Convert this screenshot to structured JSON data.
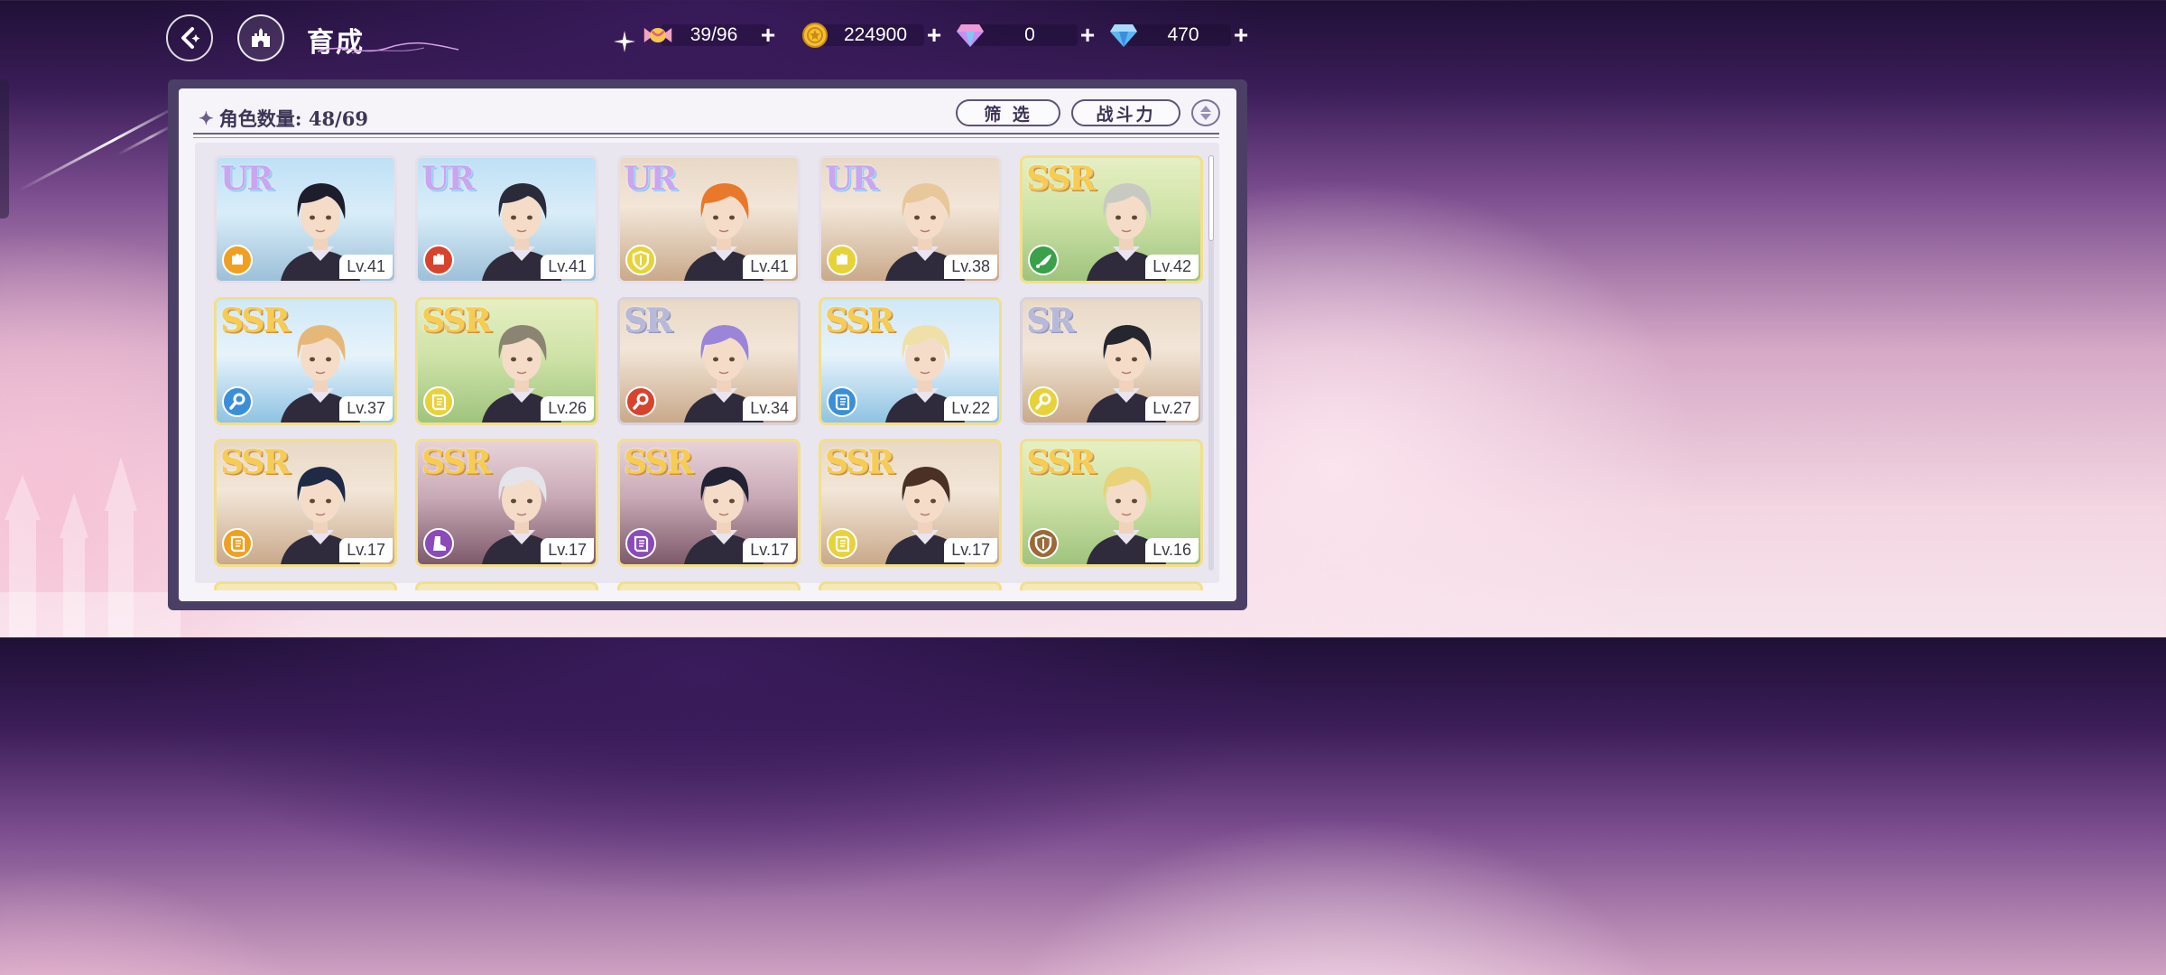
{
  "header": {
    "title": "育成",
    "back_icon": "back-arrow-icon",
    "home_icon": "castle-icon"
  },
  "resources": [
    {
      "name": "candy",
      "icon": "candy-icon",
      "value": "39/96"
    },
    {
      "name": "gold",
      "icon": "gold-coin-icon",
      "value": "224900"
    },
    {
      "name": "pink-gem",
      "icon": "pink-diamond-icon",
      "value": "0"
    },
    {
      "name": "blue-gem",
      "icon": "blue-diamond-icon",
      "value": "470"
    }
  ],
  "panel": {
    "count_label": "角色数量: 48/69",
    "filter_label": "筛 选",
    "sort_label": "战斗力"
  },
  "cards": [
    {
      "rarity": "UR",
      "level": "Lv.41",
      "attr": "fist",
      "attr_color": "#f0a020",
      "hair": "#1e1d2b",
      "bg": "city"
    },
    {
      "rarity": "UR",
      "level": "Lv.41",
      "attr": "fist",
      "attr_color": "#d8432e",
      "hair": "#2a2a3a",
      "bg": "city"
    },
    {
      "rarity": "UR",
      "level": "Lv.41",
      "attr": "shield",
      "attr_color": "#e7d23a",
      "hair": "#e9782a",
      "bg": "town"
    },
    {
      "rarity": "UR",
      "level": "Lv.38",
      "attr": "fist",
      "attr_color": "#e7d23a",
      "hair": "#e8c79a",
      "bg": "town"
    },
    {
      "rarity": "SSR",
      "level": "Lv.42",
      "attr": "horn",
      "attr_color": "#3aa04a",
      "hair": "#c9c9c4",
      "bg": "forest"
    },
    {
      "rarity": "SSR",
      "level": "Lv.37",
      "attr": "magnifier",
      "attr_color": "#3a8fd8",
      "hair": "#e6b878",
      "bg": "lake"
    },
    {
      "rarity": "SSR",
      "level": "Lv.26",
      "attr": "book",
      "attr_color": "#e7d23a",
      "hair": "#8b8472",
      "bg": "forest"
    },
    {
      "rarity": "SR",
      "level": "Lv.34",
      "attr": "magnifier",
      "attr_color": "#d8432e",
      "hair": "#9b85d8",
      "bg": "town"
    },
    {
      "rarity": "SSR",
      "level": "Lv.22",
      "attr": "book",
      "attr_color": "#3a8fd8",
      "hair": "#efe0a8",
      "bg": "lake"
    },
    {
      "rarity": "SR",
      "level": "Lv.27",
      "attr": "magnifier",
      "attr_color": "#e7d23a",
      "hair": "#26262e",
      "bg": "town"
    },
    {
      "rarity": "SSR",
      "level": "Lv.17",
      "attr": "book",
      "attr_color": "#f0a020",
      "hair": "#1f2a44",
      "bg": "town"
    },
    {
      "rarity": "SSR",
      "level": "Lv.17",
      "attr": "boot",
      "attr_color": "#8a4ab8",
      "hair": "#e4e4ea",
      "bg": "temple"
    },
    {
      "rarity": "SSR",
      "level": "Lv.17",
      "attr": "book",
      "attr_color": "#8a4ab8",
      "hair": "#222233",
      "bg": "temple"
    },
    {
      "rarity": "SSR",
      "level": "Lv.17",
      "attr": "book",
      "attr_color": "#e7d23a",
      "hair": "#4a3025",
      "bg": "town"
    },
    {
      "rarity": "SSR",
      "level": "Lv.16",
      "attr": "shield",
      "attr_color": "#9a6a3a",
      "hair": "#e8d27a",
      "bg": "forest"
    }
  ]
}
